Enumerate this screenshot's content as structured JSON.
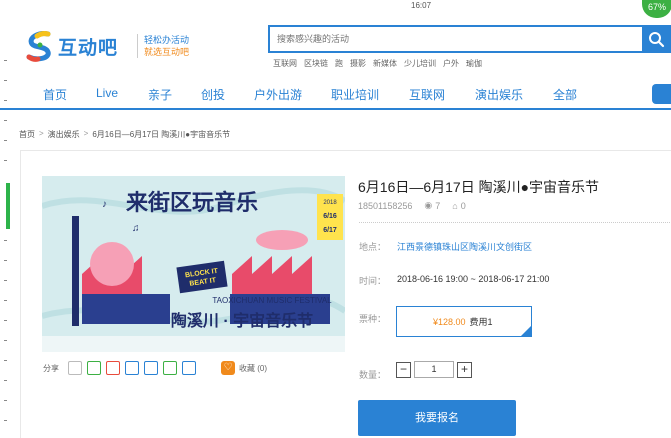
{
  "topstrip": {
    "time": "16:07",
    "gauge": "67%"
  },
  "header": {
    "logo_text": "互动吧",
    "slogan_line1": "轻松办活动",
    "slogan_line2": "就选互动吧",
    "search_placeholder": "搜索感兴趣的活动",
    "hot_tags": [
      "互联网",
      "区块链",
      "跑",
      "摄影",
      "新媒体",
      "少儿培训",
      "户外",
      "瑜伽"
    ]
  },
  "nav": {
    "items": [
      "首页",
      "Live",
      "亲子",
      "创投",
      "户外出游",
      "职业培训",
      "互联网",
      "演出娱乐",
      "全部"
    ]
  },
  "breadcrumb": [
    "首页",
    "演出娱乐",
    "6月16日—6月17日 陶溪川●宇宙音乐节"
  ],
  "poster": {
    "headline": "来街区玩音乐",
    "dates": [
      "2018",
      "6/16",
      "6/17"
    ],
    "badge_line1": "BLOCK IT",
    "badge_line2": "BEAT IT",
    "festival_en": "TAOXICHUAN MUSIC FESTIVAL",
    "festival_cn": "陶溪川 · 宇宙音乐节"
  },
  "share": {
    "label": "分享",
    "fav_label": "收藏 (0)"
  },
  "event": {
    "title": "6月16日—6月17日 陶溪川●宇宙音乐节",
    "phone": "18501158256",
    "views": "7",
    "likes": "0",
    "location_label": "地点：",
    "location": "江西景德镇珠山区陶溪川文创街区",
    "time_label": "时间：",
    "time": "2018-06-16 19:00 ~ 2018-06-17 21:00",
    "ticket_label": "票种：",
    "ticket_price": "¥128.00",
    "ticket_name": "费用1",
    "qty_label": "数量：",
    "qty_value": "1",
    "minus": "−",
    "plus": "+",
    "signup_label": "我要报名"
  },
  "colors": {
    "brand_blue": "#2a82d4",
    "accent_orange": "#f08a1c"
  }
}
